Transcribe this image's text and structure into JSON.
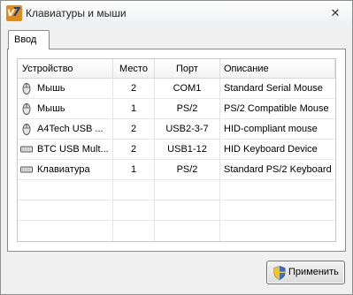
{
  "window": {
    "title": "Клавиатуры и мыши",
    "app_icon": "v7",
    "close_glyph": "✕"
  },
  "tabs": [
    {
      "label": "Ввод",
      "selected": true
    }
  ],
  "table": {
    "columns": [
      "Устройство",
      "Место",
      "Порт",
      "Описание"
    ],
    "rows": [
      {
        "icon": "mouse-icon",
        "device": "Мышь",
        "place": "2",
        "port": "COM1",
        "description": "Standard Serial Mouse"
      },
      {
        "icon": "mouse-icon",
        "device": "Мышь",
        "place": "1",
        "port": "PS/2",
        "description": "PS/2 Compatible Mouse"
      },
      {
        "icon": "mouse-icon",
        "device": "A4Tech USB ...",
        "place": "2",
        "port": "USB2-3-7",
        "description": "HID-compliant mouse"
      },
      {
        "icon": "keyboard-icon",
        "device": "BTC USB Mult...",
        "place": "2",
        "port": "USB1-12",
        "description": "HID Keyboard Device"
      },
      {
        "icon": "keyboard-icon",
        "device": "Клавиатура",
        "place": "1",
        "port": "PS/2",
        "description": "Standard PS/2 Keyboard"
      }
    ]
  },
  "buttons": {
    "apply_label": "Применить",
    "apply_icon": "uac-shield-icon"
  }
}
